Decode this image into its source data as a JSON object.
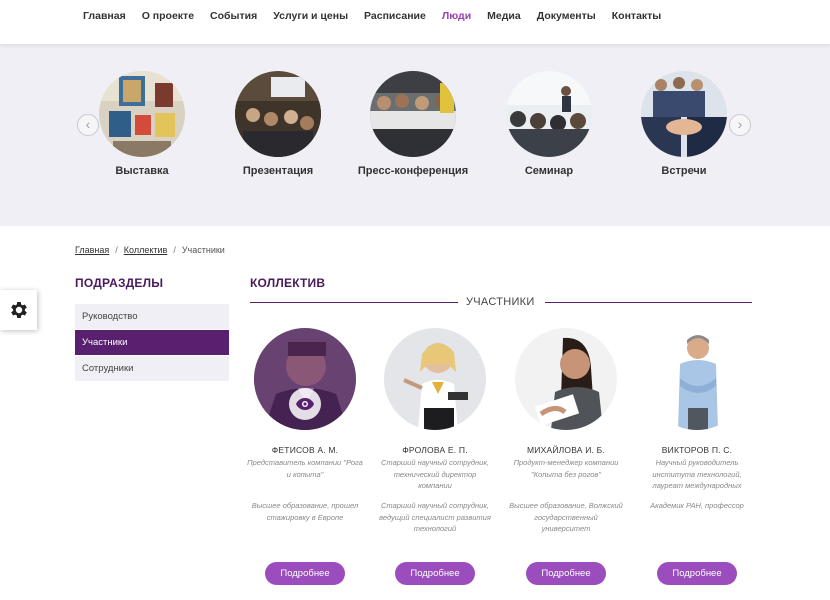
{
  "nav": {
    "items": [
      {
        "label": "Главная",
        "active": false
      },
      {
        "label": "О проекте",
        "active": false
      },
      {
        "label": "События",
        "active": false
      },
      {
        "label": "Услуги и цены",
        "active": false
      },
      {
        "label": "Расписание",
        "active": false
      },
      {
        "label": "Люди",
        "active": true
      },
      {
        "label": "Медиа",
        "active": false
      },
      {
        "label": "Документы",
        "active": false
      },
      {
        "label": "Контакты",
        "active": false
      }
    ],
    "active_color": "#9b3fb3"
  },
  "events": {
    "prev_icon": "chevron-left-icon",
    "next_icon": "chevron-right-icon",
    "items": [
      {
        "label": "Выставка"
      },
      {
        "label": "Презентация"
      },
      {
        "label": "Пресс-конференция"
      },
      {
        "label": "Семинар"
      },
      {
        "label": "Встречи"
      }
    ]
  },
  "breadcrumb": {
    "items": [
      "Главная",
      "Коллектив",
      "Участники"
    ],
    "separator": "/"
  },
  "sidebar": {
    "title": "ПОДРАЗДЕЛЫ",
    "items": [
      {
        "label": "Руководство",
        "active": false
      },
      {
        "label": "Участники",
        "active": true
      },
      {
        "label": "Сотрудники",
        "active": false
      }
    ]
  },
  "main": {
    "title": "КОЛЛЕКТИВ",
    "subtitle": "УЧАСТНИКИ",
    "more_label": "Подробнее",
    "members": [
      {
        "name": "ФЕТИСОВ А. М.",
        "position": "Представитель компании \"Рога и копыта\"",
        "education": "Высшее образование, прошел стажировку в Европе"
      },
      {
        "name": "ФРОЛОВА Е. П.",
        "position": "Старший научный сотрудник, технический директор компании",
        "education": "Старший научный сотрудник, ведущий специалист развития технологий"
      },
      {
        "name": "МИХАЙЛОВА И. Б.",
        "position": "Продукт-менеджер компании \"Копыта без рогов\"",
        "education": "Высшее образование, Волжский государственный университет"
      },
      {
        "name": "ВИКТОРОВ П. С.",
        "position": "Научный руководитель института технологий, лауреат международных",
        "education": "Академик РАН, профессор"
      }
    ]
  },
  "colors": {
    "accent": "#5a2070",
    "button": "#9b4dbd",
    "events_bg": "#efeff5"
  },
  "settings_icon": "gear-icon"
}
